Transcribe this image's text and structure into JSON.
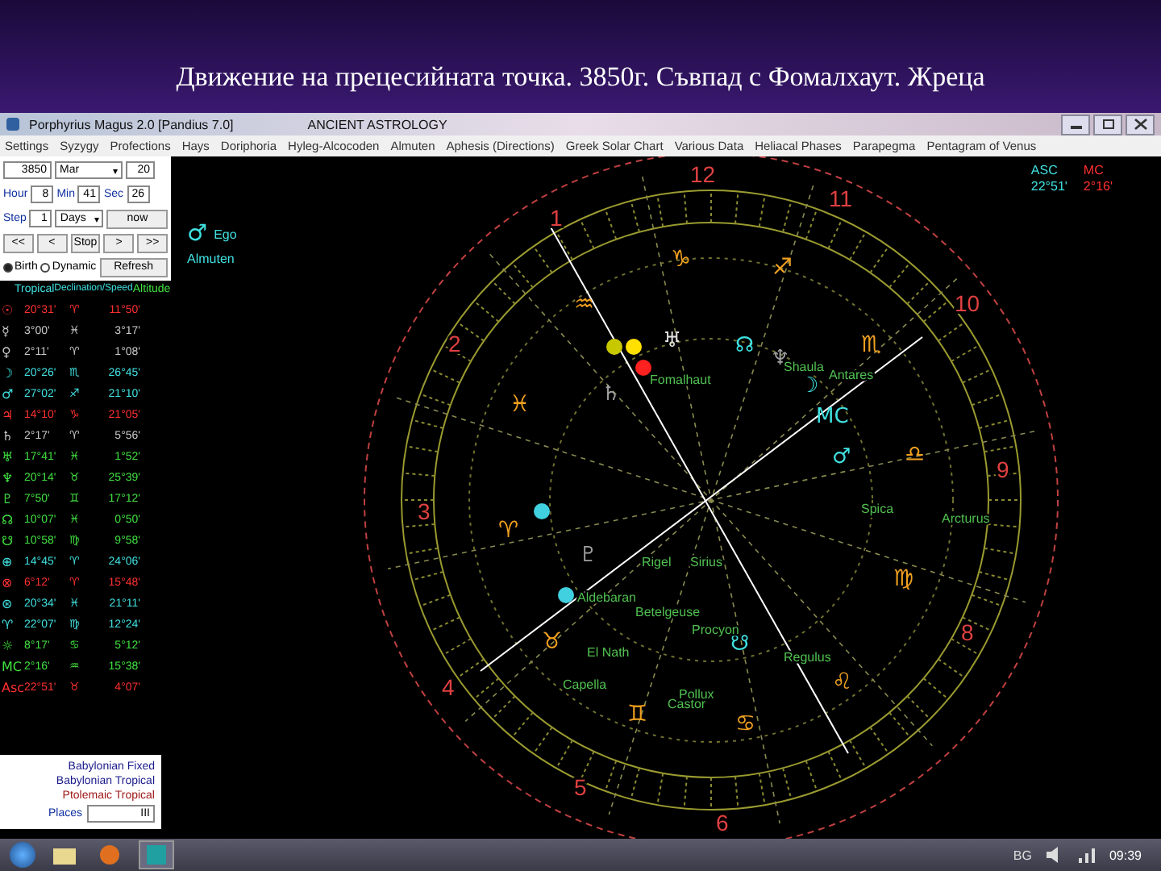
{
  "slide_title": "Движение на прецесийната точка. 3850г. Съвпад с Фомалхаут. Жреца",
  "window": {
    "title": "Porphyrius Magus 2.0 [Pandius 7.0]",
    "subtitle": "ANCIENT ASTROLOGY"
  },
  "menu": [
    "Settings",
    "Syzygy",
    "Profections",
    "Hays",
    "Doriphoria",
    "Hyleg-Alcocoden",
    "Almuten",
    "Aphesis (Directions)",
    "Greek Solar Chart",
    "Various Data",
    "Heliacal Phases",
    "Parapegma",
    "Pentagram of Venus"
  ],
  "date": {
    "year": "3850",
    "month": "Mar",
    "caret": "▾",
    "day": "20"
  },
  "time": {
    "hour_label": "Hour",
    "hour": "8",
    "min_label": "Min",
    "min": "41",
    "sec_label": "Sec",
    "sec": "26"
  },
  "step": {
    "label": "Step",
    "value": "1",
    "unit": "Days",
    "caret": "▾",
    "now": "now"
  },
  "nav_buttons": [
    "<<",
    "<",
    "Stop",
    ">",
    ">>"
  ],
  "modes": [
    {
      "label": "Birth",
      "selected": true
    },
    {
      "label": "Dynamic",
      "selected": false
    }
  ],
  "refresh": "Refresh",
  "table": {
    "columns": [
      "Tropical",
      "Declination/Speed",
      "Altitude"
    ],
    "rows": [
      {
        "glyph": "☉",
        "lon": "20°31'",
        "sign": "♈",
        "decl": "11°50'",
        "color": "#ff3030"
      },
      {
        "glyph": "☿",
        "lon": "3°00'",
        "sign": "♓",
        "decl": "3°17'",
        "color": "#c8c8c8"
      },
      {
        "glyph": "♀",
        "lon": "2°11'",
        "sign": "♈",
        "decl": "1°08'",
        "color": "#c8c8c8"
      },
      {
        "glyph": "☽",
        "lon": "20°26'",
        "sign": "♏",
        "decl": "26°45'",
        "color": "#40e0e0"
      },
      {
        "glyph": "♂",
        "lon": "27°02'",
        "sign": "♐",
        "decl": "21°10'",
        "color": "#40e0e0"
      },
      {
        "glyph": "♃",
        "lon": "14°10'",
        "sign": "♑",
        "decl": "21°05'",
        "color": "#ff3030"
      },
      {
        "glyph": "♄",
        "lon": "2°17'",
        "sign": "♈",
        "decl": "5°56'",
        "color": "#c8c8c8"
      },
      {
        "glyph": "♅",
        "lon": "17°41'",
        "sign": "♓",
        "decl": "1°52'",
        "color": "#40e040"
      },
      {
        "glyph": "♆",
        "lon": "20°14'",
        "sign": "♉",
        "decl": "25°39'",
        "color": "#40e040"
      },
      {
        "glyph": "♇",
        "lon": "7°50'",
        "sign": "♊",
        "decl": "17°12'",
        "color": "#40e040"
      },
      {
        "glyph": "☊",
        "lon": "10°07'",
        "sign": "♓",
        "decl": "0°50'",
        "color": "#40e040"
      },
      {
        "glyph": "☋",
        "lon": "10°58'",
        "sign": "♍",
        "decl": "9°58'",
        "color": "#40e040"
      },
      {
        "glyph": "⊕",
        "lon": "14°45'",
        "sign": "♈",
        "decl": "24°06'",
        "color": "#40e0e0"
      },
      {
        "glyph": "⊗",
        "lon": "6°12'",
        "sign": "♈",
        "decl": "15°48'",
        "color": "#ff3030"
      },
      {
        "glyph": "⊛",
        "lon": "20°34'",
        "sign": "♓",
        "decl": "21°11'",
        "color": "#40e0e0"
      },
      {
        "glyph": "♈",
        "lon": "22°07'",
        "sign": "♍",
        "decl": "12°24'",
        "color": "#40e0e0"
      },
      {
        "glyph": "☼",
        "lon": "8°17'",
        "sign": "♋",
        "decl": "5°12'",
        "color": "#40e040"
      },
      {
        "glyph": "MC",
        "lon": "2°16'",
        "sign": "♒",
        "decl": "15°38'",
        "color": "#40e040"
      },
      {
        "glyph": "Asc",
        "lon": "22°51'",
        "sign": "♉",
        "decl": "4°07'",
        "color": "#ff3030"
      }
    ]
  },
  "systems": [
    {
      "label": "Babylonian Fixed",
      "color": "#1a1a8c"
    },
    {
      "label": "Babylonian Tropical",
      "color": "#1a1a8c"
    },
    {
      "label": "Ptolemaic Tropical",
      "color": "#a01818"
    }
  ],
  "places": {
    "label": "Places",
    "value": "III"
  },
  "chart": {
    "legend": [
      {
        "glyph": "♂",
        "label": "Ego"
      },
      {
        "label": "Almuten"
      }
    ],
    "house_numbers": [
      "1",
      "2",
      "3",
      "4",
      "5",
      "6",
      "8",
      "9",
      "10",
      "11",
      "12"
    ],
    "signs": [
      "♑",
      "♒",
      "♓",
      "♈",
      "♉",
      "♊",
      "♋",
      "♌",
      "♍",
      "♎",
      "♏",
      "♐"
    ],
    "planets": [
      {
        "glyph": "♅",
        "color": "#e0e0e0"
      },
      {
        "glyph": "☊",
        "color": "#40e0e0"
      },
      {
        "glyph": "♆",
        "color": "#a0a0a0"
      },
      {
        "glyph": "☽",
        "color": "#40e0e0"
      },
      {
        "glyph": "MC",
        "color": "#40e0e0"
      },
      {
        "glyph": "♂",
        "color": "#40e0e0"
      },
      {
        "glyph": "♄",
        "color": "#a0a0a0"
      },
      {
        "glyph": "♇",
        "color": "#a0a0a0"
      },
      {
        "glyph": "☋",
        "color": "#40e0e0"
      }
    ],
    "stars": [
      "Fomalhaut",
      "Shaula",
      "Antares",
      "Spica",
      "Arcturus",
      "Rigel",
      "Sirius",
      "Aldebaran",
      "Betelgeuse",
      "Procyon",
      "El Nath",
      "Regulus",
      "Capella",
      "Pollux",
      "Castor"
    ],
    "angles": [
      {
        "label": "ASC",
        "value": "22°51'",
        "color": "#40e0e0"
      },
      {
        "label": "MC",
        "value": "2°16'",
        "color": "#ff3030"
      }
    ]
  },
  "taskbar": {
    "language": "BG",
    "clock": "09:39"
  }
}
